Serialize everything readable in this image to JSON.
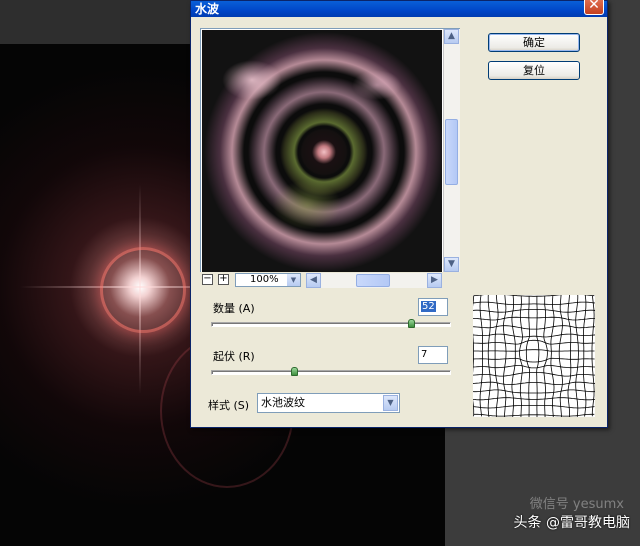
{
  "dialog": {
    "title": "水波",
    "close_label": "✕",
    "ok_label": "确定",
    "reset_label": "复位"
  },
  "preview": {
    "zoom_out_label": "−",
    "zoom_in_label": "+",
    "zoom": "100%"
  },
  "controls": {
    "amount_label": "数量 (A)",
    "amount_value": "52",
    "amount_fraction": 0.84,
    "ridges_label": "起伏 (R)",
    "ridges_value": "7",
    "ridges_fraction": 0.35,
    "style_label": "样式 (S)",
    "style_value": "水池波纹"
  },
  "watermark": {
    "faint": "微信号 yesumx",
    "main": "头条 @雷哥教电脑"
  },
  "icons": [
    "close-icon",
    "scroll-up-icon",
    "scroll-down-icon",
    "scroll-left-icon",
    "scroll-right-icon",
    "chevron-down-icon"
  ]
}
